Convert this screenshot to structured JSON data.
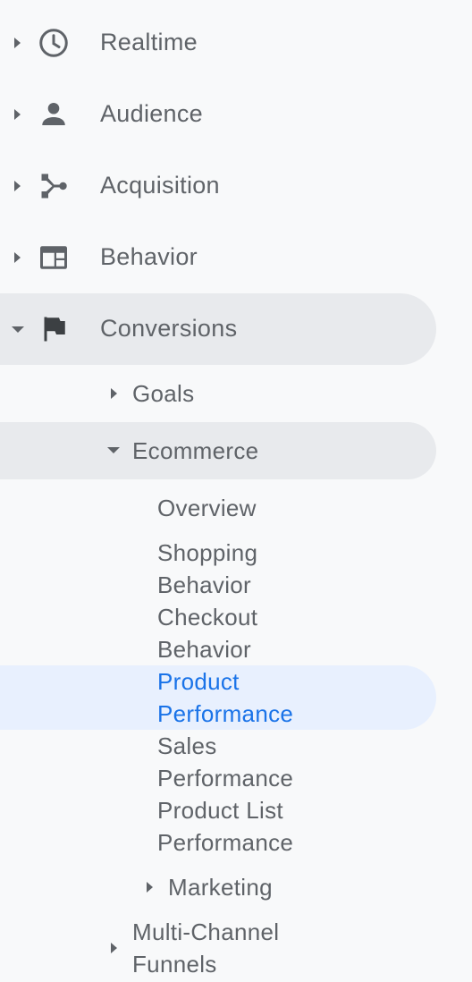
{
  "nav": {
    "items": [
      {
        "label": "Realtime",
        "icon": "clock-icon"
      },
      {
        "label": "Audience",
        "icon": "person-icon"
      },
      {
        "label": "Acquisition",
        "icon": "acquisition-icon"
      },
      {
        "label": "Behavior",
        "icon": "behavior-icon"
      },
      {
        "label": "Conversions",
        "icon": "flag-icon"
      }
    ],
    "conversions": {
      "goals": "Goals",
      "ecommerce": "Ecommerce",
      "ecommerce_items": {
        "overview": "Overview",
        "shopping_behavior_1": "Shopping",
        "shopping_behavior_2": "Behavior",
        "checkout_behavior_1": "Checkout",
        "checkout_behavior_2": "Behavior",
        "product_performance_1": "Product",
        "product_performance_2": "Performance",
        "sales_performance_1": "Sales",
        "sales_performance_2": "Performance",
        "product_list_performance_1": "Product List",
        "product_list_performance_2": "Performance"
      },
      "marketing": "Marketing",
      "multi_channel_1": "Multi-Channel",
      "multi_channel_2": "Funnels"
    },
    "colors": {
      "text": "#5f6368",
      "active": "#1a73e8",
      "expanded_bg": "#e8eaed",
      "selected_bg": "#e8f0fe"
    }
  }
}
